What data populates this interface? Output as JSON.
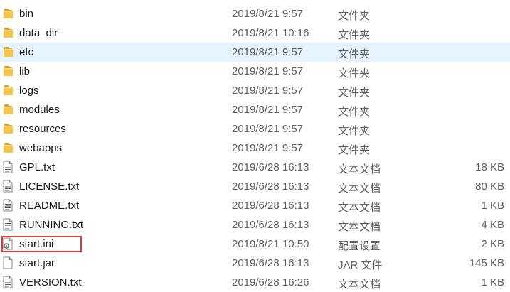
{
  "colors": {
    "folder": "#f5c44b",
    "folder_dark": "#dca52e",
    "selected_row": "#e5f3ff",
    "highlight": "#d93a3a"
  },
  "files": [
    {
      "name": "bin",
      "modified": "2019/8/21 9:57",
      "type": "文件夹",
      "size": "",
      "icon": "folder-icon"
    },
    {
      "name": "data_dir",
      "modified": "2019/8/21 10:16",
      "type": "文件夹",
      "size": "",
      "icon": "folder-icon"
    },
    {
      "name": "etc",
      "modified": "2019/8/21 9:57",
      "type": "文件夹",
      "size": "",
      "icon": "folder-icon",
      "selected": true
    },
    {
      "name": "lib",
      "modified": "2019/8/21 9:57",
      "type": "文件夹",
      "size": "",
      "icon": "folder-icon"
    },
    {
      "name": "logs",
      "modified": "2019/8/21 9:57",
      "type": "文件夹",
      "size": "",
      "icon": "folder-icon"
    },
    {
      "name": "modules",
      "modified": "2019/8/21 9:57",
      "type": "文件夹",
      "size": "",
      "icon": "folder-icon"
    },
    {
      "name": "resources",
      "modified": "2019/8/21 9:57",
      "type": "文件夹",
      "size": "",
      "icon": "folder-icon"
    },
    {
      "name": "webapps",
      "modified": "2019/8/21 9:57",
      "type": "文件夹",
      "size": "",
      "icon": "folder-icon"
    },
    {
      "name": "GPL.txt",
      "modified": "2019/6/28 16:13",
      "type": "文本文档",
      "size": "18 KB",
      "icon": "text-file-icon"
    },
    {
      "name": "LICENSE.txt",
      "modified": "2019/6/28 16:13",
      "type": "文本文档",
      "size": "80 KB",
      "icon": "text-file-icon"
    },
    {
      "name": "README.txt",
      "modified": "2019/6/28 16:13",
      "type": "文本文档",
      "size": "1 KB",
      "icon": "text-file-icon"
    },
    {
      "name": "RUNNING.txt",
      "modified": "2019/6/28 16:13",
      "type": "文本文档",
      "size": "4 KB",
      "icon": "text-file-icon"
    },
    {
      "name": "start.ini",
      "modified": "2019/8/21 10:50",
      "type": "配置设置",
      "size": "2 KB",
      "icon": "settings-file-icon"
    },
    {
      "name": "start.jar",
      "modified": "2019/6/28 16:13",
      "type": "JAR 文件",
      "size": "145 KB",
      "icon": "blank-file-icon"
    },
    {
      "name": "VERSION.txt",
      "modified": "2019/6/28 16:26",
      "type": "文本文档",
      "size": "1 KB",
      "icon": "text-file-icon"
    }
  ]
}
